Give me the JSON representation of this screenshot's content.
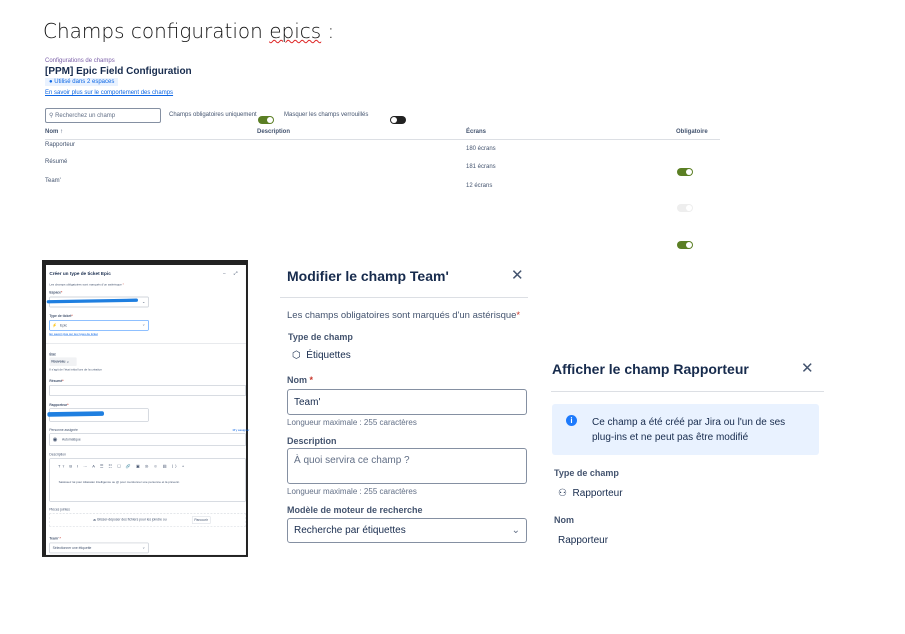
{
  "doc_title_prefix": "Champs configuration ",
  "doc_title_word": "epics",
  "doc_title_suffix": " :",
  "config": {
    "breadcrumb": "Configurations de champs",
    "title": "[PPM] Epic Field Configuration",
    "badge": "Utilisé dans 2 espaces",
    "learn_link": "En savoir plus sur le comportement des champs",
    "search_placeholder": "Recherchez un champ",
    "toggle_required_label": "Champs obligatoires uniquement",
    "toggle_required_on": true,
    "toggle_locked_label": "Masquer les champs verrouillés",
    "toggle_locked_on": false,
    "columns": [
      "Nom",
      "Description",
      "Écrans",
      "Obligatoire"
    ],
    "rows": [
      {
        "name": "Rapporteur",
        "description": "",
        "screens": "180 écrans",
        "required": true
      },
      {
        "name": "Résumé",
        "description": "",
        "screens": "181 écrans",
        "required": true,
        "locked": true
      },
      {
        "name": "Team'",
        "description": "",
        "screens": "12 écrans",
        "required": true
      }
    ]
  },
  "create": {
    "title": "Créer un type de ticket Epic",
    "required_note": "Les champs obligatoires sont marqués d'un astérisque",
    "space_label": "Espace",
    "type_label": "Type de ticket",
    "type_value": "Epic",
    "type_link": "En savoir plus sur les types de ticket",
    "status_label": "État",
    "status_value": "Nouveau",
    "status_hint": "Il s'agit de l'état initial lors de la création",
    "summary_label": "Résumé",
    "reporter_label": "Rapporteur",
    "assignee_label": "Personne assignée",
    "assign_me": "M'y assigner",
    "assignee_value": "Automatique",
    "description_label": "Description",
    "description_placeholder": "Saisissez /ai pour Atlassian Intelligence ou @ pour mentionner une personne et la prévenir.",
    "attachments_label": "Pièces jointes",
    "drop_text": "Glisser-déposer des fichiers pour les joindre ou",
    "browse": "Parcourir",
    "team_label": "Team'",
    "team_placeholder": "Sélectionner une étiquette"
  },
  "edit": {
    "title": "Modifier le champ Team'",
    "required_note": "Les champs obligatoires sont marqués d'un astérisque",
    "type_label": "Type de champ",
    "type_value": "Étiquettes",
    "name_label": "Nom",
    "name_value": "Team'",
    "name_hint": "Longueur maximale : 255 caractères",
    "desc_label": "Description",
    "desc_placeholder": "À quoi servira ce champ ?",
    "desc_hint": "Longueur maximale : 255 caractères",
    "search_label": "Modèle de moteur de recherche",
    "search_value": "Recherche par étiquettes"
  },
  "view": {
    "title": "Afficher le champ Rapporteur",
    "info": "Ce champ a été créé par Jira ou l'un de ses plug-ins et ne peut pas être modifié",
    "type_label": "Type de champ",
    "type_value": "Rapporteur",
    "name_label": "Nom",
    "name_value": "Rapporteur"
  },
  "colors": {
    "accent": "#0c66e4",
    "toggle_on": "#5b7f24",
    "required": "#c9372c",
    "info_bg": "#e9f2ff"
  }
}
